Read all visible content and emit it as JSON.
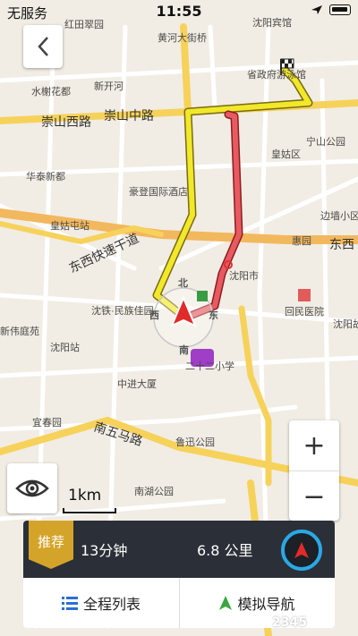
{
  "status_bar": {
    "carrier": "无服务",
    "time": "11:55"
  },
  "map": {
    "roads": [
      "崇山西路",
      "崇山中路",
      "东西快速干道",
      "南五马路",
      "东西"
    ],
    "places": [
      "红田翠园",
      "黄河大街桥",
      "沈阳宾馆",
      "省政府游泳馆",
      "水榭花都",
      "新开河",
      "宁山公园",
      "皇姑区",
      "华泰新都",
      "豪登国际酒店",
      "皇姑屯站",
      "边墙小区",
      "惠园",
      "沈阳市",
      "回民医院",
      "沈铁·民族佳园",
      "沈阳站",
      "沈阳故",
      "新伟庭苑",
      "二十二小学",
      "中进大厦",
      "宜春园",
      "鲁迅公园",
      "南湖公园"
    ],
    "heading_labels": {
      "north": "北",
      "east": "东",
      "south": "南",
      "west": "西"
    }
  },
  "scale_label": "1km",
  "zoom": {
    "in_label": "+",
    "out_label": "−"
  },
  "route": {
    "badge": "推荐",
    "duration": "13分钟",
    "distance": "6.8 公里"
  },
  "actions": {
    "list": "全程列表",
    "simulate": "模拟导航"
  },
  "watermark": "2345"
}
